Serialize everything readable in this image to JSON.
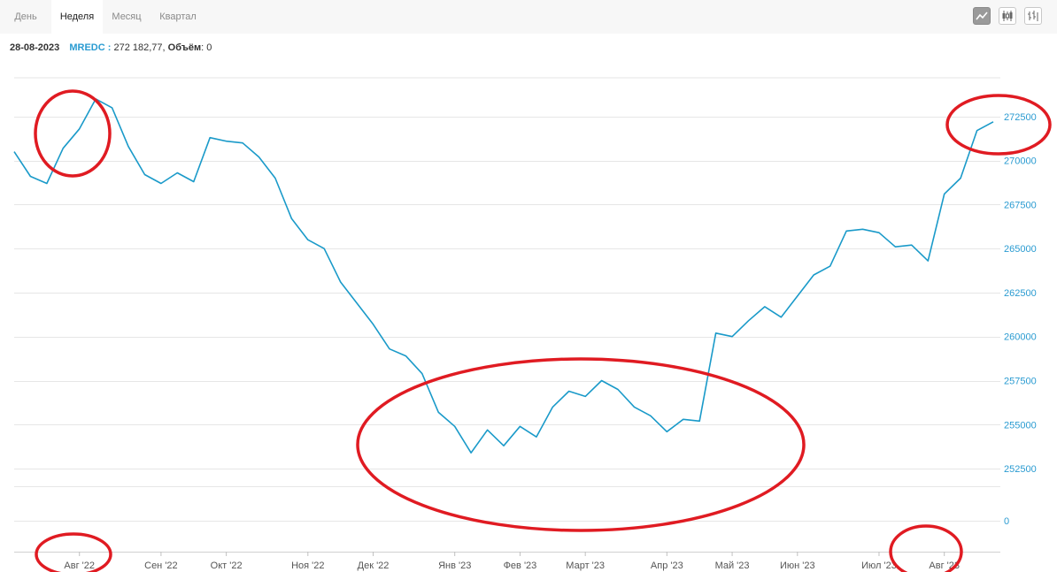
{
  "tabs": [
    {
      "label": "День",
      "active": false
    },
    {
      "label": "Неделя",
      "active": true
    },
    {
      "label": "Месяц",
      "active": false
    },
    {
      "label": "Квартал",
      "active": false
    }
  ],
  "toolbar": {
    "buttons": [
      {
        "icon": "line-chart-icon",
        "active": true
      },
      {
        "icon": "candlestick-icon",
        "active": false
      },
      {
        "icon": "ohlc-bars-icon",
        "active": false
      }
    ]
  },
  "info": {
    "date": "28-08-2023",
    "ticker": "MREDC",
    "separator": " : ",
    "value": "272 182,77",
    "volume_label": "Объём",
    "volume_value": "0"
  },
  "colors": {
    "line": "#1a9ac9",
    "annotation": "#e01b22",
    "grid": "#e6e6e6"
  },
  "chart_data": {
    "type": "line",
    "ylim": [
      251500,
      274700
    ],
    "yticks": [
      252500,
      255000,
      257500,
      260000,
      262500,
      265000,
      267500,
      270000,
      272500
    ],
    "volume_tick": 0,
    "x_labels": [
      "Авг '22",
      "Сен '22",
      "Окт '22",
      "Ноя '22",
      "Дек '22",
      "Янв '23",
      "Фев '23",
      "Март '23",
      "Апр '23",
      "Май '23",
      "Июн '23",
      "Июл '23",
      "Авг '23"
    ],
    "x_label_weeks": [
      4,
      9,
      13,
      18,
      22,
      27,
      31,
      35,
      40,
      44,
      48,
      53,
      57
    ],
    "series": [
      {
        "values": [
          270500,
          269100,
          268700,
          270700,
          271800,
          273500,
          273000,
          270800,
          269200,
          268700,
          269300,
          268800,
          271300,
          271100,
          271000,
          270200,
          269000,
          266700,
          265500,
          265000,
          263100,
          261900,
          260700,
          259300,
          258900,
          257900,
          255700,
          254900,
          253400,
          254700,
          253800,
          254900,
          254300,
          256000,
          256900,
          256600,
          257500,
          257000,
          256000,
          255500,
          254600,
          255300,
          255200,
          260200,
          260000,
          260900,
          261700,
          261100,
          262300,
          263500,
          264000,
          266000,
          266100,
          265900,
          265100,
          265200,
          264300,
          268100,
          269000,
          271700,
          272200
        ]
      }
    ]
  }
}
